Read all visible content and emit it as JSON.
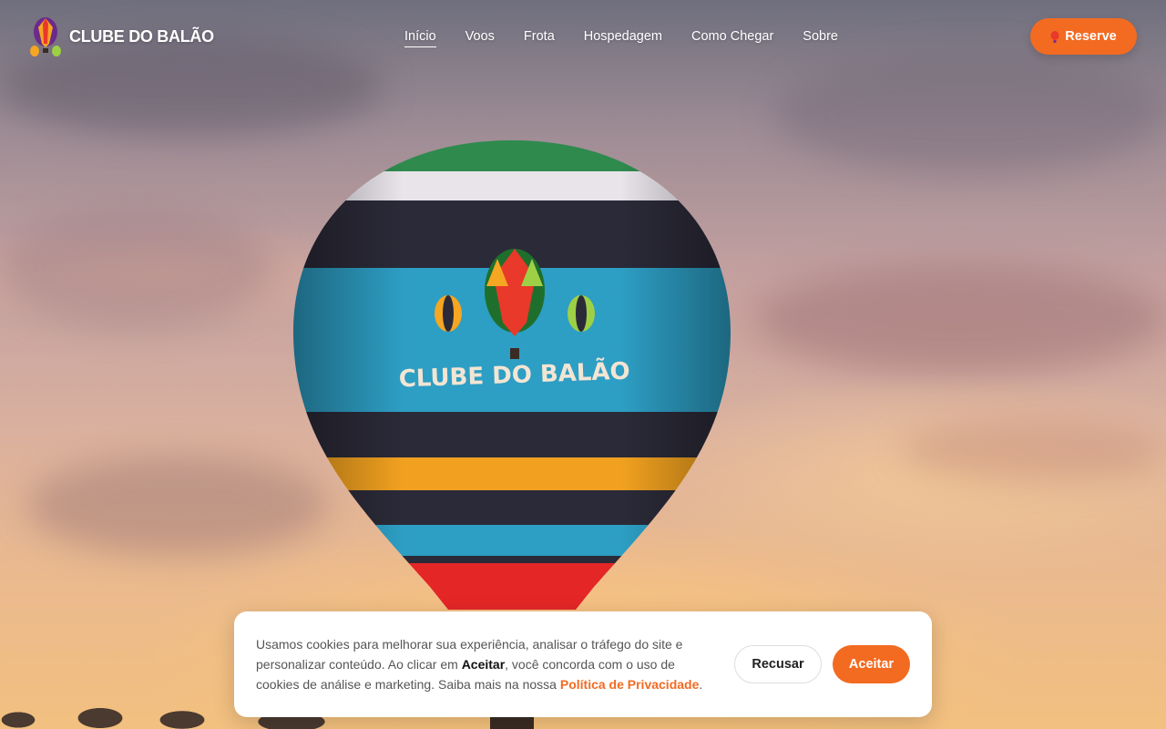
{
  "brand": {
    "name": "CLUBE DO BALÃO",
    "logo_icon": "hot-air-balloon-icon"
  },
  "nav": {
    "links": [
      {
        "label": "Início",
        "active": true
      },
      {
        "label": "Voos",
        "active": false
      },
      {
        "label": "Frota",
        "active": false
      },
      {
        "label": "Hospedagem",
        "active": false
      },
      {
        "label": "Como Chegar",
        "active": false
      },
      {
        "label": "Sobre",
        "active": false
      }
    ],
    "reserve": {
      "label": "Reserve",
      "icon": "balloon-icon"
    }
  },
  "hero": {
    "balloon_text": "CLUBE DO BALÃO"
  },
  "cookie": {
    "text_before": "Usamos cookies para melhorar sua experiência, analisar o tráfego do site e personalizar conteúdo. Ao clicar em ",
    "accept_word": "Aceitar",
    "text_middle": ", você concorda com o uso de cookies de análise e marketing. Saiba mais na nossa ",
    "policy_link": "Política de Privacidade",
    "text_after": ".",
    "decline_label": "Recusar",
    "accept_label": "Aceitar"
  },
  "colors": {
    "accent": "#f26b21"
  }
}
